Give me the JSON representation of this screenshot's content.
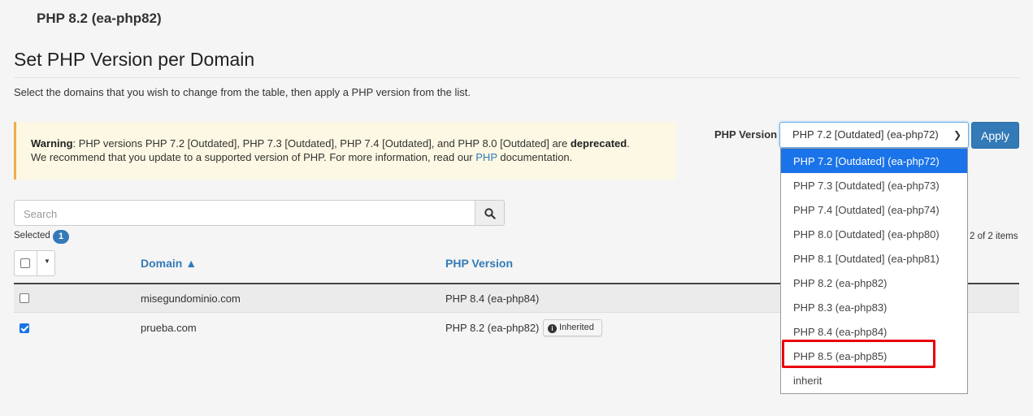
{
  "current_version": "PHP 8.2 (ea-php82)",
  "page_title": "Set PHP Version per Domain",
  "intro": "Select the domains that you wish to change from the table, then apply a PHP version from the list.",
  "warning": {
    "label": "Warning",
    "text1": ": PHP versions PHP 7.2 [Outdated], PHP 7.3 [Outdated], PHP 7.4 [Outdated], and PHP 8.0 [Outdated] are ",
    "deprecated": "deprecated",
    "text1_end": ".",
    "text2": "We recommend that you update to a supported version of PHP. For more information, read our ",
    "link": "PHP",
    "text2_end": " documentation."
  },
  "php_version_label": "PHP Version",
  "selected_option": "PHP 7.2 [Outdated] (ea-php72)",
  "apply_label": "Apply",
  "search_placeholder": "Search",
  "selected_label": "Selected",
  "selected_count": "1",
  "items_count": "2 of 2 items",
  "table": {
    "headers": {
      "domain": "Domain ▲",
      "php_version": "PHP Version"
    },
    "rows": [
      {
        "domain": "misegundominio.com",
        "php_version": "PHP 8.4 (ea-php84)",
        "checked": false
      },
      {
        "domain": "prueba.com",
        "php_version": "PHP 8.2 (ea-php82)",
        "checked": true,
        "badge": "Inherited"
      }
    ]
  },
  "options": [
    "PHP 7.2 [Outdated] (ea-php72)",
    "PHP 7.3 [Outdated] (ea-php73)",
    "PHP 7.4 [Outdated] (ea-php74)",
    "PHP 8.0 [Outdated] (ea-php80)",
    "PHP 8.1 [Outdated] (ea-php81)",
    "PHP 8.2 (ea-php82)",
    "PHP 8.3 (ea-php83)",
    "PHP 8.4 (ea-php84)",
    "PHP 8.5 (ea-php85)",
    "inherit"
  ],
  "colors": {
    "accent": "#337ab7",
    "selection": "#1a73e8",
    "highlight": "#e8000d",
    "warning_bg": "#fcf8e3"
  }
}
